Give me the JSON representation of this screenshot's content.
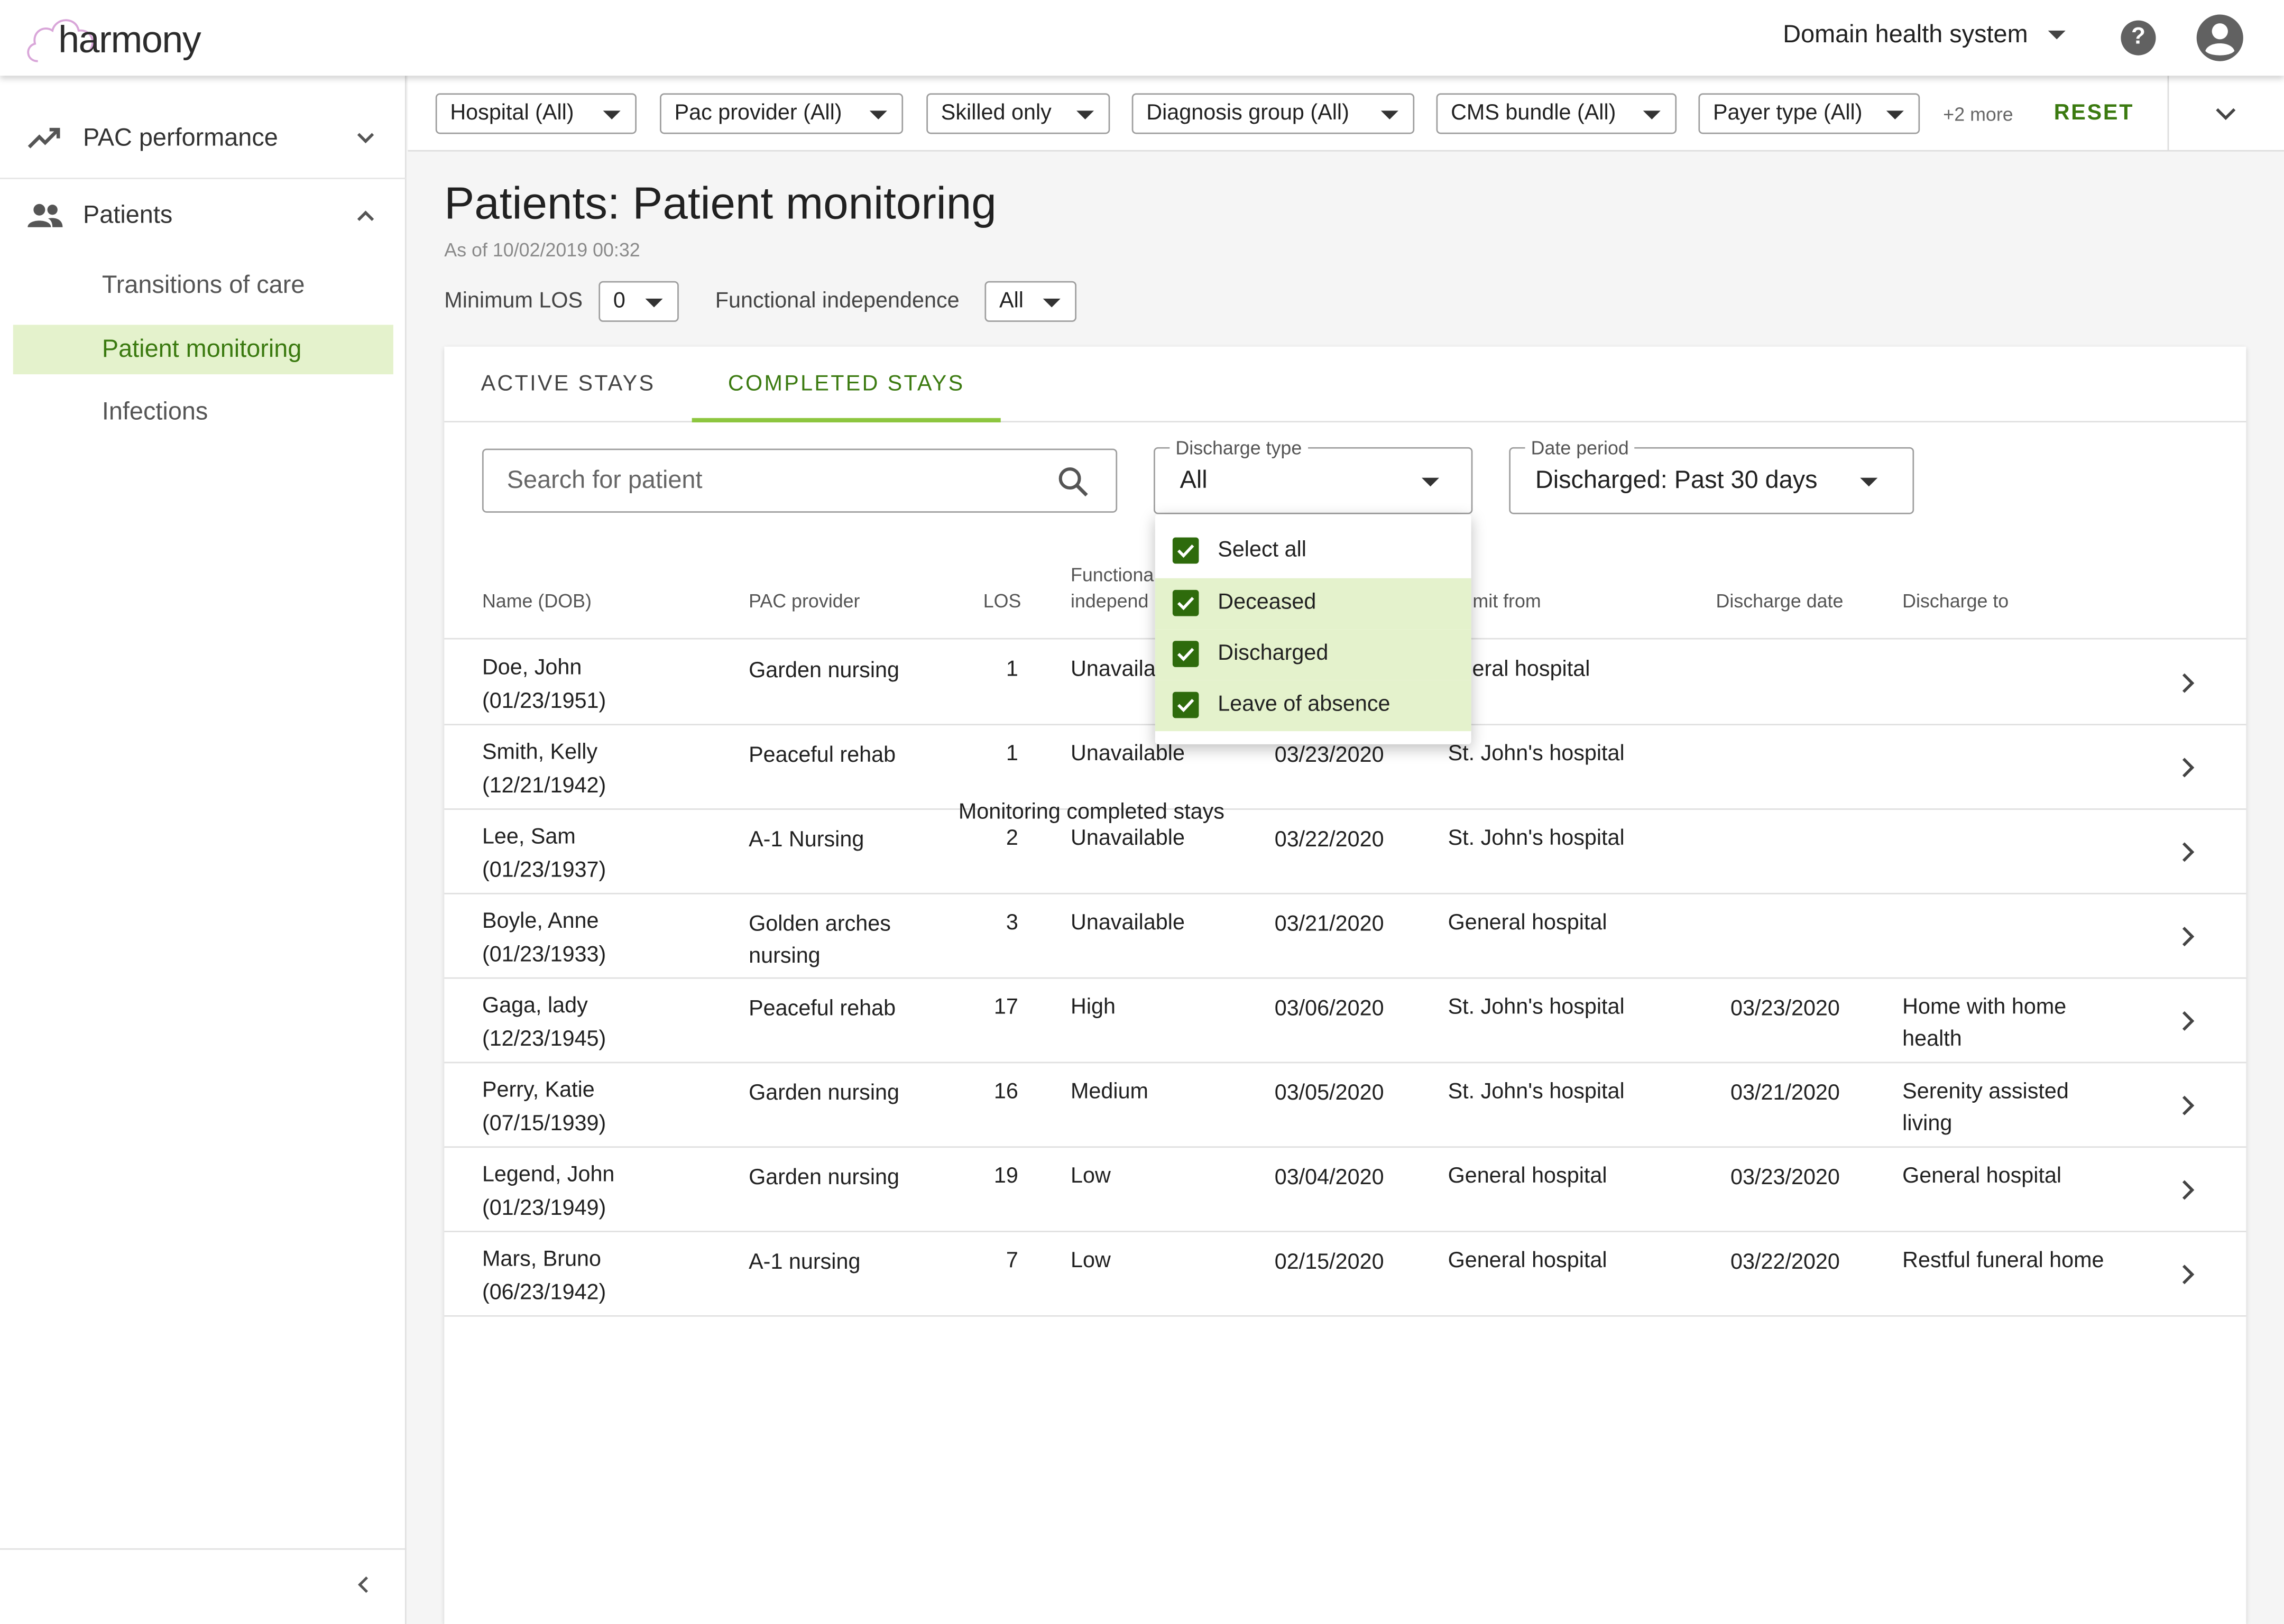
{
  "app": {
    "logo": "harmony",
    "organization": "Domain health system",
    "colors": {
      "accent": "#3b7a10",
      "highlight": "#e4f2cc",
      "indicator": "#8dc63f"
    }
  },
  "sidebar": {
    "sections": [
      {
        "label": "PAC performance",
        "icon": "trending-up-icon",
        "expanded": false
      },
      {
        "label": "Patients",
        "icon": "people-icon",
        "expanded": true
      }
    ],
    "sub_items": [
      {
        "label": "Transitions of care",
        "active": false
      },
      {
        "label": "Patient monitoring",
        "active": true
      },
      {
        "label": "Infections",
        "active": false
      }
    ]
  },
  "filters": {
    "chips": [
      "Hospital (All)",
      "Pac provider (All)",
      "Skilled only",
      "Diagnosis group (All)",
      "CMS bundle (All)",
      "Payer type (All)"
    ],
    "more": "+2 more",
    "reset": "RESET"
  },
  "page": {
    "title": "Patients: Patient monitoring",
    "as_of": "As of 10/02/2019 00:32",
    "min_los_label": "Minimum LOS",
    "min_los_value": "0",
    "func_label": "Functional independence",
    "func_value": "All"
  },
  "tabs": [
    {
      "label": "ACTIVE STAYS",
      "active": false
    },
    {
      "label": "COMPLETED STAYS",
      "active": true
    }
  ],
  "search": {
    "placeholder": "Search for patient"
  },
  "discharge_type": {
    "label": "Discharge type",
    "value": "All"
  },
  "date_period": {
    "label": "Date period",
    "value": "Discharged: Past 30 days"
  },
  "dropdown": {
    "items": [
      {
        "label": "Select all",
        "checked": true
      },
      {
        "label": "Deceased",
        "checked": true
      },
      {
        "label": "Discharged",
        "checked": true
      },
      {
        "label": "Leave of absence",
        "checked": true
      }
    ]
  },
  "tooltip": "Monitoring completed stays",
  "table": {
    "headers": {
      "name": "Name (DOB)",
      "provider": "PAC provider",
      "los": "LOS",
      "func_l1": "Functiona",
      "func_l2": "independ",
      "admit": "mit from",
      "discharge_date": "Discharge date",
      "discharge_to": "Discharge to"
    },
    "rows": [
      {
        "name": "Doe, John",
        "dob": "(01/23/1951)",
        "provider": "Garden nursing",
        "provider2": "",
        "los": "1",
        "func": "Unavaila",
        "admit_date": "",
        "admit_from": "eneral hospital",
        "discharge_date": "",
        "to": "",
        "to2": ""
      },
      {
        "name": "Smith, Kelly",
        "dob": "(12/21/1942)",
        "provider": "Peaceful rehab",
        "provider2": "",
        "los": "1",
        "func": "Unavailable",
        "admit_date": "03/23/2020",
        "admit_from": "St. John's hospital",
        "discharge_date": "",
        "to": "",
        "to2": ""
      },
      {
        "name": "Lee, Sam",
        "dob": "(01/23/1937)",
        "provider": "A-1 Nursing",
        "provider2": "",
        "los": "2",
        "func": "Unavailable",
        "admit_date": "03/22/2020",
        "admit_from": "St. John's hospital",
        "discharge_date": "",
        "to": "",
        "to2": ""
      },
      {
        "name": "Boyle, Anne",
        "dob": "(01/23/1933)",
        "provider": "Golden arches",
        "provider2": "nursing",
        "los": "3",
        "func": "Unavailable",
        "admit_date": "03/21/2020",
        "admit_from": "General hospital",
        "discharge_date": "",
        "to": "",
        "to2": ""
      },
      {
        "name": "Gaga, lady",
        "dob": "(12/23/1945)",
        "provider": "Peaceful rehab",
        "provider2": "",
        "los": "17",
        "func": "High",
        "admit_date": "03/06/2020",
        "admit_from": "St. John's hospital",
        "discharge_date": "03/23/2020",
        "to": "Home with home",
        "to2": "health"
      },
      {
        "name": "Perry, Katie",
        "dob": "(07/15/1939)",
        "provider": "Garden nursing",
        "provider2": "",
        "los": "16",
        "func": "Medium",
        "admit_date": "03/05/2020",
        "admit_from": "St. John's hospital",
        "discharge_date": "03/21/2020",
        "to": "Serenity assisted",
        "to2": "living"
      },
      {
        "name": "Legend, John",
        "dob": "(01/23/1949)",
        "provider": "Garden nursing",
        "provider2": "",
        "los": "19",
        "func": "Low",
        "admit_date": "03/04/2020",
        "admit_from": "General hospital",
        "discharge_date": "03/23/2020",
        "to": "General hospital",
        "to2": ""
      },
      {
        "name": "Mars, Bruno",
        "dob": "(06/23/1942)",
        "provider": "A-1 nursing",
        "provider2": "",
        "los": "7",
        "func": "Low",
        "admit_date": "02/15/2020",
        "admit_from": "General hospital",
        "discharge_date": "03/22/2020",
        "to": "Restful funeral home",
        "to2": ""
      }
    ]
  }
}
